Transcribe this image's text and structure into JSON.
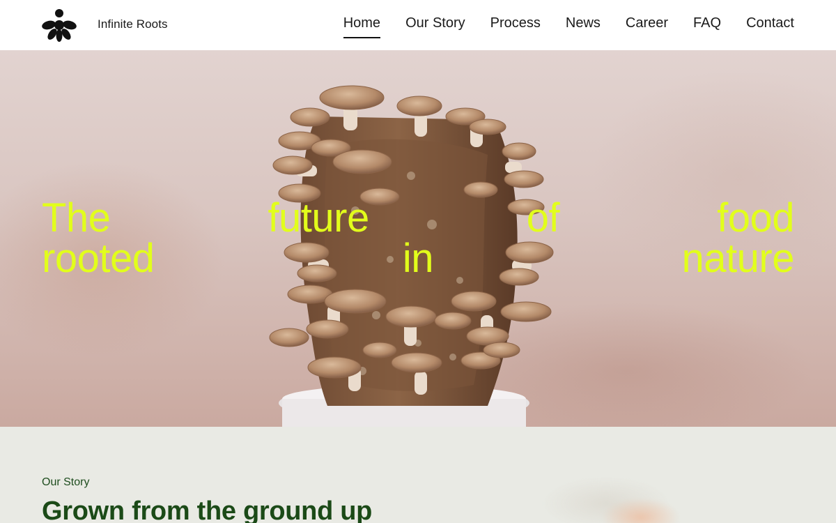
{
  "header": {
    "brand": "Infinite Roots",
    "logo_icon": "infinite-roots-logo-icon",
    "nav": [
      {
        "label": "Home",
        "active": true
      },
      {
        "label": "Our Story",
        "active": false
      },
      {
        "label": "Process",
        "active": false
      },
      {
        "label": "News",
        "active": false
      },
      {
        "label": "Career",
        "active": false
      },
      {
        "label": "FAQ",
        "active": false
      },
      {
        "label": "Contact",
        "active": false
      }
    ]
  },
  "hero": {
    "line1": [
      "The",
      "future",
      "of",
      "food"
    ],
    "line2": [
      "rooted",
      "in",
      "nature"
    ],
    "headline_color": "#e2ff1b",
    "image": "shiitake-mushroom-block-photo"
  },
  "story": {
    "eyebrow": "Our Story",
    "heading": "Grown from the ground up"
  }
}
